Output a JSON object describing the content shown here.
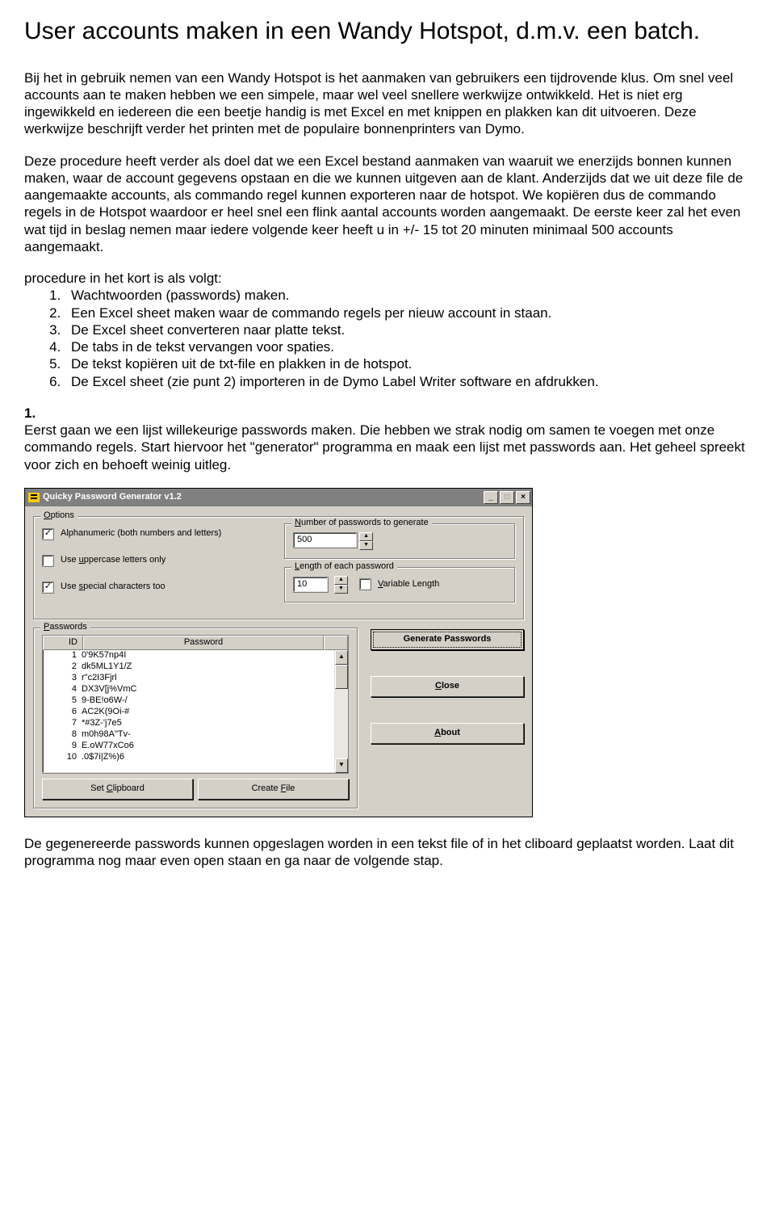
{
  "title": "User accounts maken in een Wandy Hotspot, d.m.v. een batch.",
  "para1": "Bij het in gebruik nemen van een Wandy Hotspot is het aanmaken van gebruikers een tijdrovende klus. Om snel veel accounts aan te maken hebben we een simpele, maar wel veel snellere werkwijze ontwikkeld. Het is niet erg ingewikkeld en iedereen die een beetje handig is met Excel en met knippen en plakken kan dit uitvoeren. Deze werkwijze beschrijft verder het printen met  de populaire bonnenprinters van Dymo.",
  "para2": "Deze procedure heeft verder als doel dat we een Excel bestand aanmaken van waaruit we enerzijds bonnen kunnen maken, waar de account gegevens opstaan en die we kunnen uitgeven aan de klant. Anderzijds dat we uit deze file de aangemaakte accounts, als commando regel kunnen exporteren naar de hotspot. We kopiëren dus de commando regels in de Hotspot waardoor er heel snel een flink aantal accounts worden aangemaakt. De eerste keer zal het even wat tijd in beslag nemen maar iedere volgende keer heeft u in +/- 15 tot 20 minuten minimaal 500 accounts aangemaakt.",
  "proc_intro": "procedure in het kort is als volgt:",
  "steps": [
    "Wachtwoorden (passwords) maken.",
    "Een Excel sheet maken waar de commando regels per nieuw account in staan.",
    "De Excel sheet converteren naar platte tekst.",
    "De tabs in de tekst vervangen voor spaties.",
    "De tekst kopiëren uit de txt-file en plakken in de hotspot.",
    "De Excel sheet (zie punt 2) importeren in de Dymo Label Writer software en afdrukken."
  ],
  "step1_heading": "1.",
  "step1_text": "Eerst gaan we een lijst willekeurige passwords maken. Die hebben we strak nodig om samen te voegen met onze commando regels. Start hiervoor het \"generator\" programma en maak een lijst met passwords aan. Het geheel spreekt voor zich en behoeft weinig uitleg.",
  "app": {
    "title": "Quicky Password Generator  v1.2",
    "options_legend": "Options",
    "opt_alpha": "Alphanumeric (both numbers and letters)",
    "opt_upper": "Use uppercase letters only",
    "opt_special": "Use special characters too",
    "num_legend": "Number of passwords to generate",
    "num_value": "500",
    "len_legend": "Length of each password",
    "len_value": "10",
    "var_len": "Variable Length",
    "pw_legend": "Passwords",
    "col_id": "ID",
    "col_pw": "Password",
    "rows": [
      {
        "id": "1",
        "pw": "0'9K57np4I"
      },
      {
        "id": "2",
        "pw": "dk5ML1Y1/Z"
      },
      {
        "id": "3",
        "pw": "r\"c2I3Fjrl"
      },
      {
        "id": "4",
        "pw": "DX3V[j%VmC"
      },
      {
        "id": "5",
        "pw": "9-BE!o6W-/"
      },
      {
        "id": "6",
        "pw": "AC2K(9Oi-#"
      },
      {
        "id": "7",
        "pw": "*#3Z-'j7e5"
      },
      {
        "id": "8",
        "pw": "m0h98A\"Tv-"
      },
      {
        "id": "9",
        "pw": "E.oW77xCo6"
      },
      {
        "id": "10",
        "pw": ".0$7i|Z%)6"
      }
    ],
    "btn_generate": "Generate Passwords",
    "btn_close": "Close",
    "btn_about": "About",
    "btn_clipboard": "Set Clipboard",
    "btn_file": "Create File"
  },
  "para_after": "De gegenereerde passwords kunnen opgeslagen worden in een tekst file of in het cliboard geplaatst worden. Laat dit programma nog maar even open staan en ga naar de volgende stap."
}
